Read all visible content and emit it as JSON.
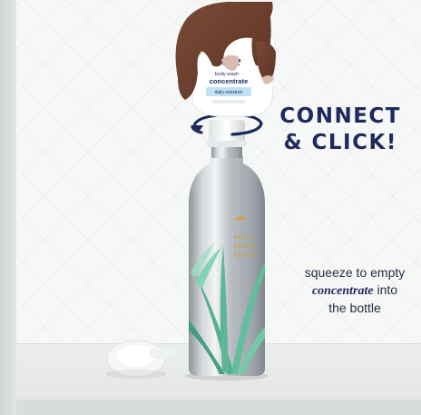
{
  "headline": {
    "line1": "CONNECT",
    "line2": "& CLICK!"
  },
  "caption": {
    "line1": "squeeze to empty",
    "emphasis": "concentrate",
    "line2_rest": " into",
    "line3": "the bottle"
  },
  "product": {
    "brand": "Dove",
    "cartridge_line1": "body wash",
    "cartridge_line2": "concentrate",
    "cartridge_variant": "daily moisture",
    "bottle_lines": [
      "REFILL",
      "REUSE",
      "REPEAT"
    ]
  },
  "colors": {
    "headline": "#1f2a5c",
    "leaf_green": "#5fbf9c",
    "bottle_silver": "#bfc4c8",
    "variant_label": "#bfe3f4"
  }
}
